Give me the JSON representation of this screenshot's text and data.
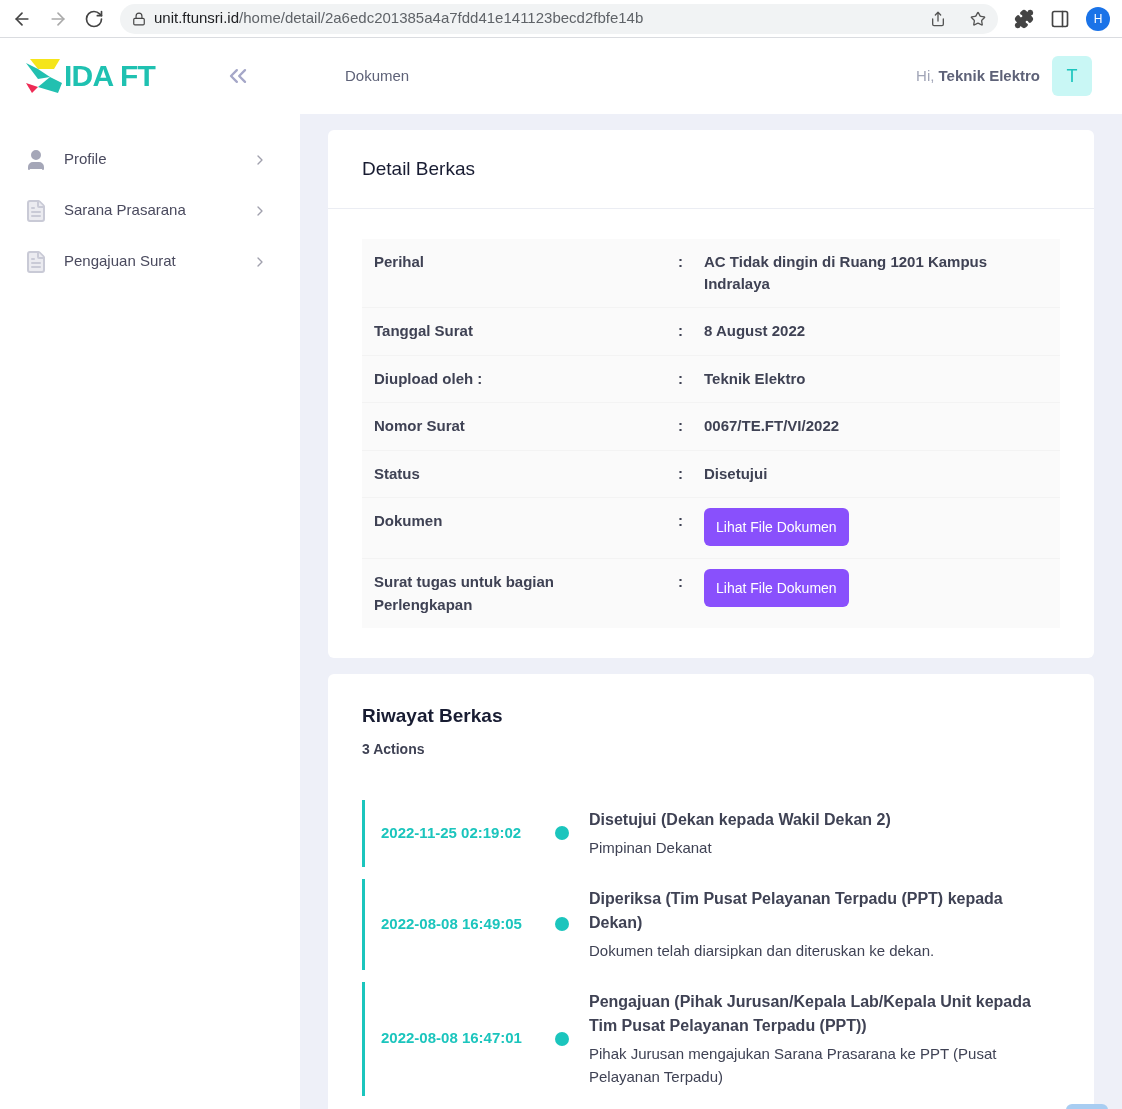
{
  "browser": {
    "url_host": "unit.ftunsri.id",
    "url_path": "/home/detail/2a6edc201385a4a7fdd41e141123becd2fbfe14b",
    "profile_initial": "H"
  },
  "sidebar": {
    "logo_text": "IDA FT",
    "items": [
      {
        "label": "Profile",
        "kind": "person"
      },
      {
        "label": "Sarana Prasarana",
        "kind": "document"
      },
      {
        "label": "Pengajuan Surat",
        "kind": "document"
      }
    ]
  },
  "header": {
    "breadcrumb": "Dokumen",
    "greeting": "Hi,",
    "user": "Teknik Elektro",
    "avatar": "T"
  },
  "detail": {
    "title": "Detail Berkas",
    "rows": [
      {
        "label": "Perihal",
        "separator": ":",
        "value": "AC Tidak dingin di Ruang 1201 Kampus Indralaya",
        "kind": "text"
      },
      {
        "label": "Tanggal Surat",
        "separator": ":",
        "value": "8 August 2022",
        "kind": "text"
      },
      {
        "label": "Diupload oleh :",
        "separator": ":",
        "value": "Teknik Elektro",
        "kind": "text"
      },
      {
        "label": "Nomor Surat",
        "separator": ":",
        "value": "0067/TE.FT/VI/2022",
        "kind": "text"
      },
      {
        "label": "Status",
        "separator": ":",
        "value": "Disetujui",
        "kind": "text"
      },
      {
        "label": "Dokumen",
        "separator": ":",
        "value": "Lihat File Dokumen",
        "kind": "button"
      },
      {
        "label": "Surat tugas untuk bagian Perlengkapan",
        "separator": ":",
        "value": "Lihat File Dokumen",
        "kind": "button"
      }
    ]
  },
  "history": {
    "title": "Riwayat Berkas",
    "count": "3 Actions",
    "items": [
      {
        "time": "2022-11-25 02:19:02",
        "title": "Disetujui (Dekan kepada Wakil Dekan 2)",
        "note": "Pimpinan Dekanat"
      },
      {
        "time": "2022-08-08 16:49:05",
        "title": "Diperiksa (Tim Pusat Pelayanan Terpadu (PPT) kepada Dekan)",
        "note": "Dokumen telah diarsipkan dan diteruskan ke dekan."
      },
      {
        "time": "2022-08-08 16:47:01",
        "title": "Pengajuan (Pihak Jurusan/Kepala Lab/Kepala Unit kepada Tim Pusat Pelayanan Terpadu (PPT))",
        "note": "Pihak Jurusan mengajukan Sarana Prasarana ke PPT (Pusat Pelayanan Terpadu)"
      }
    ]
  }
}
